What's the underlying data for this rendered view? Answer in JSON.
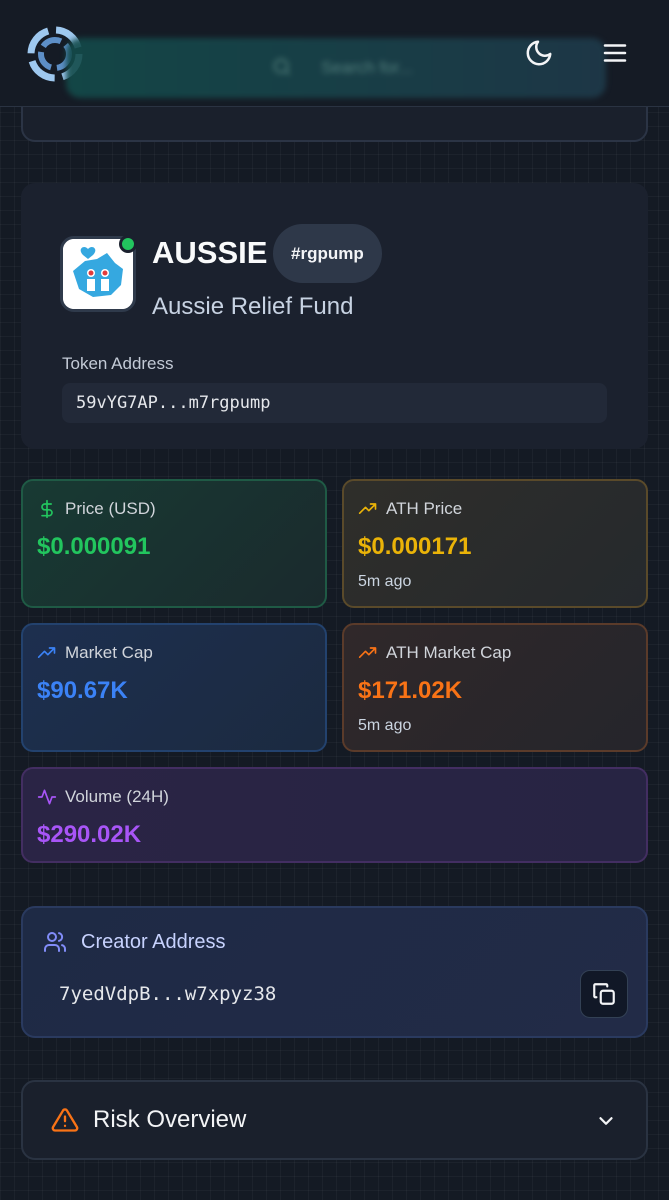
{
  "header": {
    "search_placeholder": "Search for...",
    "icons": [
      "logo-icon",
      "search-icon",
      "moon-icon",
      "menu-icon"
    ]
  },
  "token": {
    "symbol": "AUSSIE",
    "tag": "#rgpump",
    "name": "Aussie Relief Fund",
    "address_label": "Token Address",
    "address": "59vYG7AP...m7rgpump",
    "online_color": "#22c55e"
  },
  "stats": {
    "price": {
      "label": "Price (USD)",
      "value": "$0.000091",
      "color": "#22c55e",
      "icon": "dollar-icon"
    },
    "ath_price": {
      "label": "ATH Price",
      "value": "$0.000171",
      "sub": "5m ago",
      "color": "#eab308",
      "icon": "trending-up-icon"
    },
    "market_cap": {
      "label": "Market Cap",
      "value": "$90.67K",
      "color": "#3b82f6",
      "icon": "trending-up-icon"
    },
    "ath_market_cap": {
      "label": "ATH Market Cap",
      "value": "$171.02K",
      "sub": "5m ago",
      "color": "#f97316",
      "icon": "trending-up-icon"
    },
    "volume": {
      "label": "Volume (24H)",
      "value": "$290.02K",
      "color": "#a855f7",
      "icon": "activity-icon"
    }
  },
  "creator": {
    "title": "Creator Address",
    "address": "7yedVdpB...w7xpyz38",
    "icon": "users-icon"
  },
  "risk": {
    "title": "Risk Overview",
    "icon": "warning-icon"
  }
}
